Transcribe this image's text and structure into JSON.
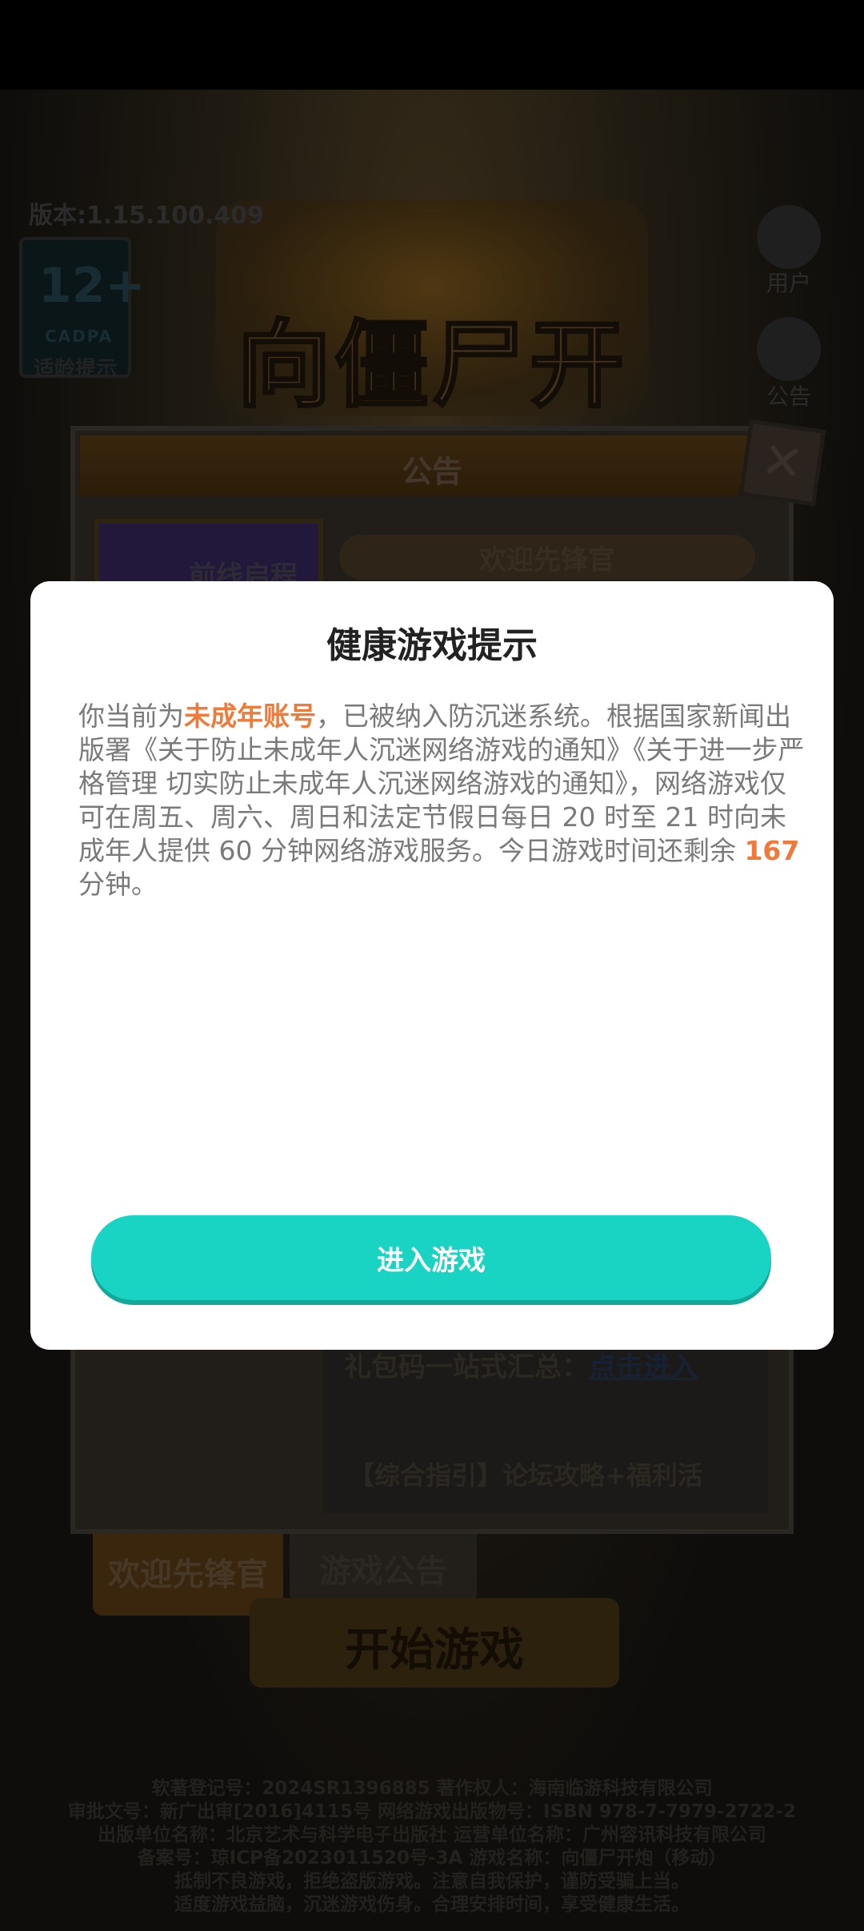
{
  "background": {
    "version": "版本:1.15.100.409",
    "logo_title": "向僵尸开炮",
    "age_rating": {
      "number": "12+",
      "org": "CADPA",
      "label": "适龄提示"
    },
    "side_buttons": {
      "user": "用户",
      "notice": "公告"
    },
    "notice_panel": {
      "header": "公告",
      "close_glyph": "✕",
      "promo_label": "前线启程",
      "welcome_pill": "欢迎先锋官",
      "gift_text": "礼包码一站式汇总：",
      "gift_link": "点击进入",
      "guide_text": "【综合指引】论坛攻略+福利活"
    },
    "tabs": {
      "welcome": "欢迎先锋官",
      "notice": "游戏公告"
    },
    "start_button": "开始游戏",
    "footer_lines": [
      "软著登记号：2024SR1396885  著作权人：海南临游科技有限公司",
      "审批文号：新广出审[2016]4115号  网络游戏出版物号：ISBN 978-7-7979-2722-2",
      "出版单位名称：北京艺术与科学电子出版社  运营单位名称：广州容讯科技有限公司",
      "备案号：琼ICP备2023011520号-3A  游戏名称：向僵尸开炮（移动）",
      "抵制不良游戏，拒绝盗版游戏。注意自我保护，谨防受骗上当。",
      "适度游戏益脑，沉迷游戏伤身。合理安排时间，享受健康生活。"
    ]
  },
  "dialog": {
    "title": "健康游戏提示",
    "body": {
      "p1": "你当前为",
      "highlight_account": "未成年账号",
      "p2": "，已被纳入防沉迷系统。根据国家新闻出版署《关于防止未成年人沉迷网络游戏的通知》《关于进一步严格管理 切实防止未成年人沉迷网络游戏的通知》，网络游戏仅可在周五、周六、周日和法定节假日每日 20 时至 21 时向未成年人提供 60 分钟网络游戏服务。今日游戏时间还剩余 ",
      "highlight_minutes": "167",
      "p3": " 分钟。"
    },
    "button_label": "进入游戏"
  },
  "colors": {
    "accent_teal": "#19d4c2",
    "highlight_orange": "#f07a3a",
    "dialog_background": "#ffffff"
  }
}
